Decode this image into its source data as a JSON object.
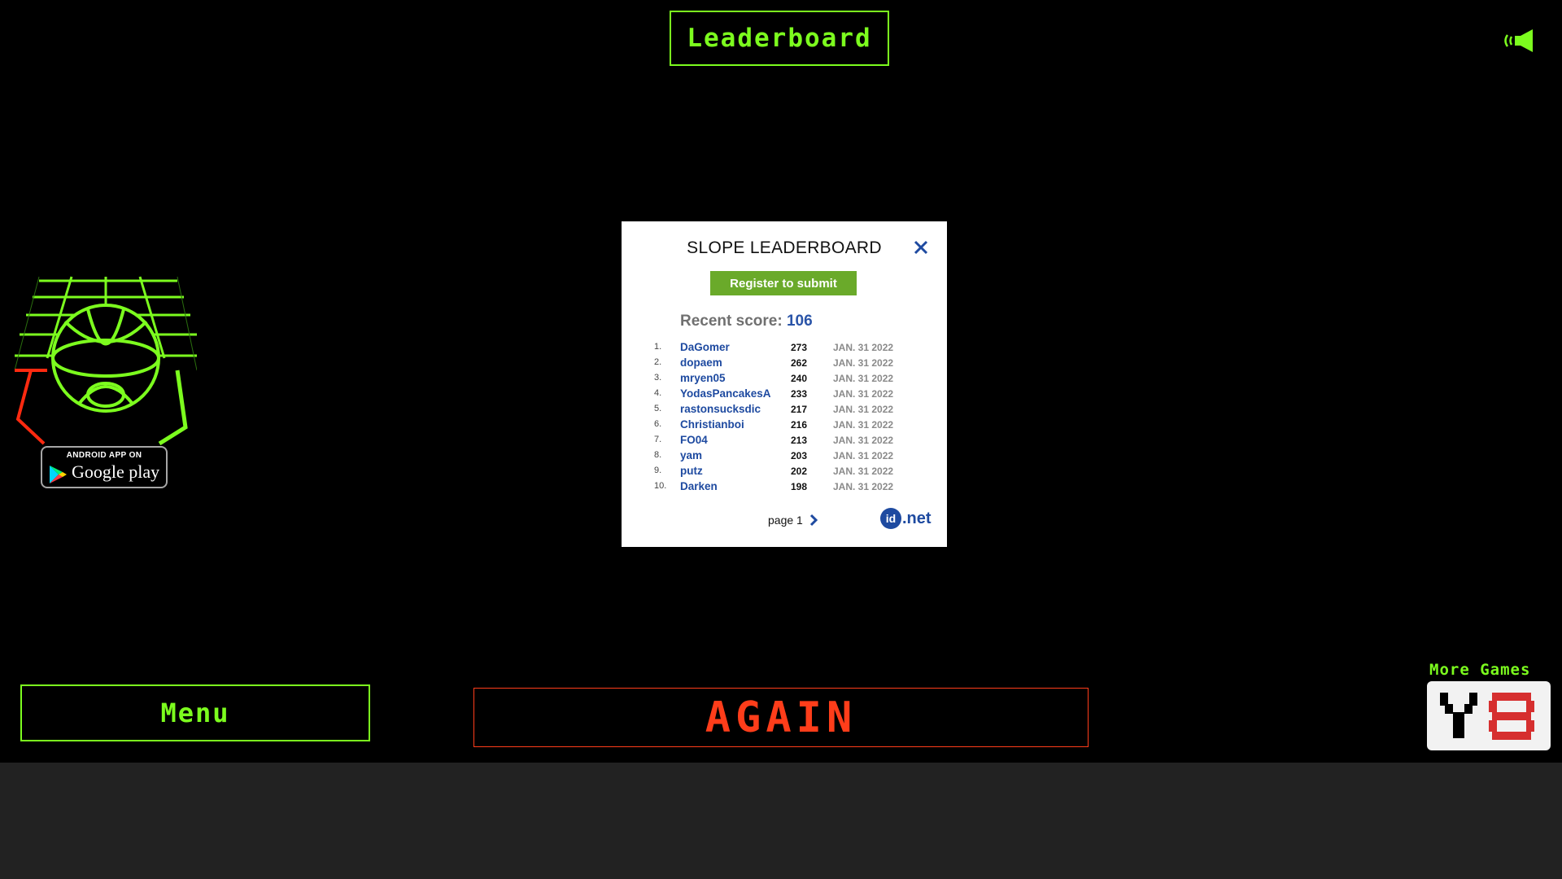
{
  "header": {
    "title": "Leaderboard"
  },
  "sound": {
    "icon": "speaker-icon"
  },
  "promo": {
    "badge_top": "ANDROID APP ON",
    "badge_brand": "Google play"
  },
  "modal": {
    "title": "SLOPE LEADERBOARD",
    "register_label": "Register to submit",
    "recent_label": "Recent score:",
    "recent_value": "106",
    "rows": [
      {
        "rank": "1.",
        "name": "DaGomer",
        "score": "273",
        "date": "JAN. 31 2022"
      },
      {
        "rank": "2.",
        "name": "dopaem",
        "score": "262",
        "date": "JAN. 31 2022"
      },
      {
        "rank": "3.",
        "name": "mryen05",
        "score": "240",
        "date": "JAN. 31 2022"
      },
      {
        "rank": "4.",
        "name": "YodasPancakesA",
        "score": "233",
        "date": "JAN. 31 2022"
      },
      {
        "rank": "5.",
        "name": "rastonsucksdic",
        "score": "217",
        "date": "JAN. 31 2022"
      },
      {
        "rank": "6.",
        "name": "Christianboi",
        "score": "216",
        "date": "JAN. 31 2022"
      },
      {
        "rank": "7.",
        "name": "FO04",
        "score": "213",
        "date": "JAN. 31 2022"
      },
      {
        "rank": "8.",
        "name": "yam",
        "score": "203",
        "date": "JAN. 31 2022"
      },
      {
        "rank": "9.",
        "name": "putz",
        "score": "202",
        "date": "JAN. 31 2022"
      },
      {
        "rank": "10.",
        "name": "Darken",
        "score": "198",
        "date": "JAN. 31 2022"
      }
    ],
    "page_label": "page 1",
    "logo_id": "id",
    "logo_net": ".net"
  },
  "buttons": {
    "menu": "Menu",
    "again": "AGAIN",
    "more_games": "More Games"
  },
  "colors": {
    "neon_green": "#7cfc1e",
    "again_red": "#ff3d1a",
    "link_blue": "#1e4aa0",
    "register_green": "#6aaa2a"
  }
}
